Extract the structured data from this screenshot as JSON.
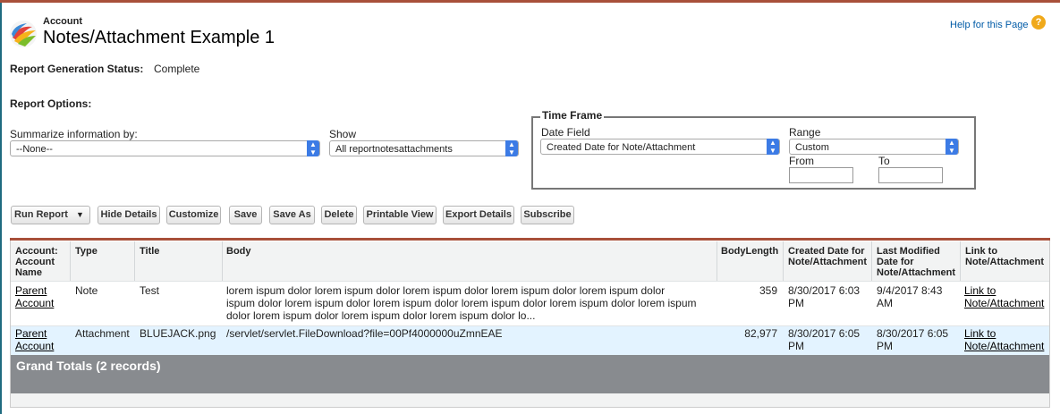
{
  "header": {
    "breadcrumb": "Account",
    "title": "Notes/Attachment Example 1",
    "help_link": "Help for this Page",
    "help_icon": "?"
  },
  "status": {
    "label": "Report Generation Status:",
    "value": "Complete"
  },
  "options": {
    "label": "Report Options:",
    "summarize_label": "Summarize information by:",
    "summarize_value": "--None--",
    "show_label": "Show",
    "show_value": "All reportnotesattachments"
  },
  "timeframe": {
    "legend": "Time Frame",
    "date_field_label": "Date Field",
    "date_field_value": "Created Date for Note/Attachment",
    "range_label": "Range",
    "range_value": "Custom",
    "from_label": "From",
    "to_label": "To",
    "from_value": "",
    "to_value": ""
  },
  "toolbar": {
    "run_report": "Run Report",
    "hide_details": "Hide Details",
    "customize": "Customize",
    "save": "Save",
    "save_as": "Save As",
    "delete": "Delete",
    "printable_view": "Printable View",
    "export_details": "Export Details",
    "subscribe": "Subscribe"
  },
  "table": {
    "headers": {
      "account": [
        "Account:",
        "Account",
        "Name"
      ],
      "type": "Type",
      "title": "Title",
      "body": "Body",
      "body_length": "BodyLength",
      "created": [
        "Created Date for",
        "Note/Attachment"
      ],
      "modified": [
        "Last Modified",
        "Date for",
        "Note/Attachment"
      ],
      "link": [
        "Link to",
        "Note/Attachment"
      ]
    },
    "rows": [
      {
        "account": [
          "Parent",
          "Account"
        ],
        "type": "Note",
        "title": "Test",
        "body": [
          "lorem ispum dolor lorem ispum dolor lorem ispum dolor lorem ispum dolor lorem ispum dolor",
          "ispum dolor lorem ispum dolor lorem ispum dolor lorem ispum dolor lorem ispum dolor lorem ispum",
          "dolor lorem ispum dolor lorem ispum dolor lorem ispum dolor lo..."
        ],
        "body_length": "359",
        "created": [
          "8/30/2017 6:03",
          "PM"
        ],
        "modified": [
          "9/4/2017 8:43",
          "AM"
        ],
        "link": [
          "Link to",
          "Note/Attachment"
        ]
      },
      {
        "account": [
          "Parent",
          "Account"
        ],
        "type": "Attachment",
        "title": "BLUEJACK.png",
        "body": [
          "/servlet/servlet.FileDownload?file=00Pf4000000uZmnEAE"
        ],
        "body_length": "82,977",
        "created": [
          "8/30/2017 6:05",
          "PM"
        ],
        "modified": [
          "8/30/2017 6:05",
          "PM"
        ],
        "link": [
          "Link to",
          "Note/Attachment"
        ]
      }
    ],
    "grand_totals": "Grand Totals (2 records)"
  }
}
